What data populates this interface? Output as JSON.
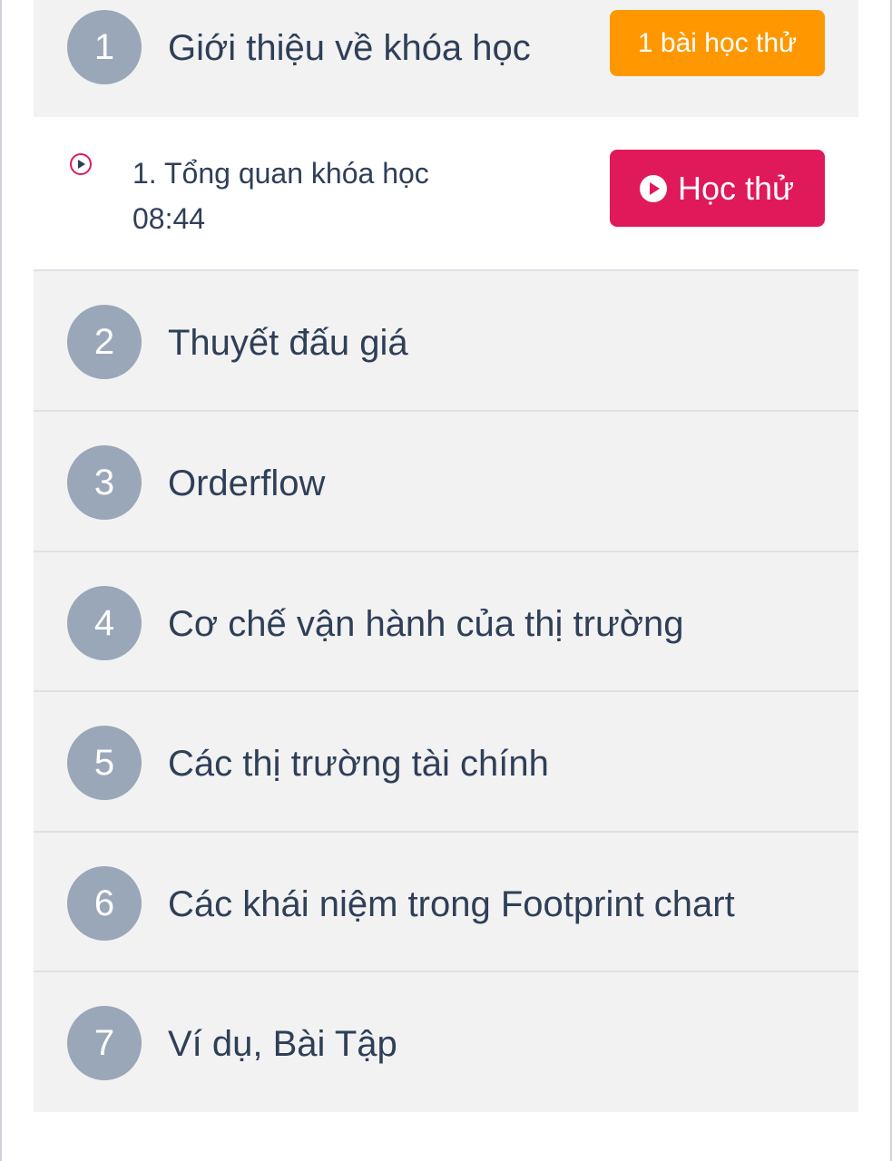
{
  "sections": [
    {
      "number": "1",
      "title": "Giới thiệu về khóa học",
      "badge": "1 bài học thử"
    },
    {
      "number": "2",
      "title": "Thuyết đấu giá"
    },
    {
      "number": "3",
      "title": "Orderflow"
    },
    {
      "number": "4",
      "title": "Cơ chế vận hành của thị trường"
    },
    {
      "number": "5",
      "title": "Các thị trường tài chính"
    },
    {
      "number": "6",
      "title": "Các khái niệm trong Footprint chart"
    },
    {
      "number": "7",
      "title": "Ví dụ, Bài Tập"
    }
  ],
  "lesson": {
    "title": "1. Tổng quan khóa học",
    "duration": "08:44",
    "trial_button": "Học thử",
    "icon": "play-circle-icon"
  },
  "colors": {
    "badge": "#ff9800",
    "accent": "#e0195a",
    "number_circle": "#9aa7b8",
    "text": "#2f3f58",
    "section_bg": "#f2f2f2"
  }
}
